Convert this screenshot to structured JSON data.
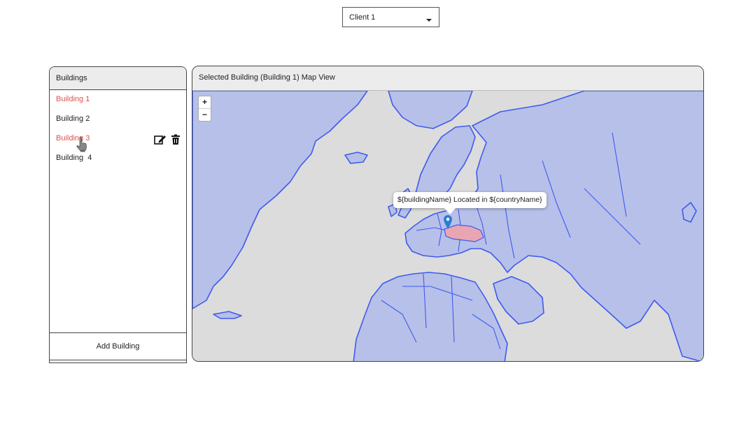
{
  "client_select": {
    "value": "Client 1"
  },
  "buildings_panel": {
    "title": "Buildings",
    "items": [
      {
        "label": "Building 1",
        "selected": true
      },
      {
        "label": "Building 2",
        "selected": false
      },
      {
        "label": "Building 3",
        "selected": true
      },
      {
        "label": "Building  4",
        "selected": false
      }
    ],
    "add_label": "Add Building",
    "icons": {
      "edit": "edit-icon",
      "delete": "trash-icon",
      "cursor": "hand-cursor-icon"
    }
  },
  "map": {
    "title": "Selected Building (Building 1) Map View",
    "zoom_in": "+",
    "zoom_out": "−",
    "popup_text": "${buildingName} Located in ${countryName}",
    "colors": {
      "land": "#b7c0e8",
      "country_border": "#3e5bf0",
      "highlight": "#e9a6b2",
      "water": "#dcdcdc",
      "marker": "#2a7fd4"
    }
  },
  "colors": {
    "selected_text": "#d9534f"
  }
}
